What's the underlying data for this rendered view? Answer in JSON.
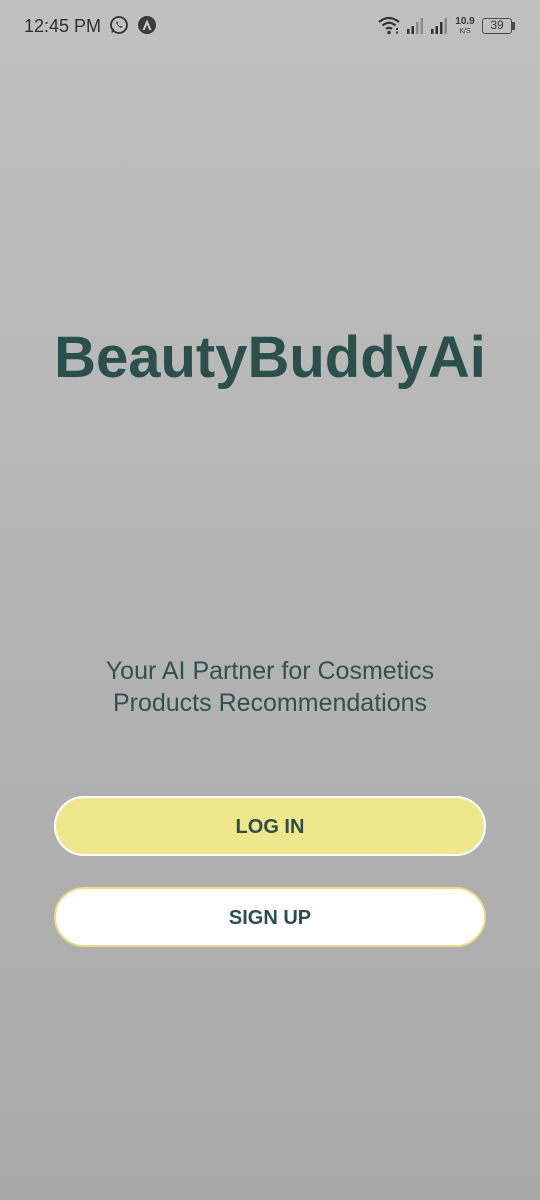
{
  "status_bar": {
    "time": "12:45 PM",
    "net_speed_value": "10.9",
    "net_speed_unit": "K/S",
    "battery_level": "39",
    "icons": [
      "whatsapp-icon",
      "app-notification-icon",
      "wifi-icon",
      "signal-icon",
      "signal-icon",
      "battery-icon"
    ]
  },
  "app": {
    "title": "BeautyBuddyAi",
    "tagline_line1": "Your AI Partner for Cosmetics",
    "tagline_line2": "Products Recommendations"
  },
  "buttons": {
    "login_label": "LOG IN",
    "signup_label": "SIGN UP"
  },
  "colors": {
    "primary_text": "#2b4f4b",
    "login_bg": "#f0e68c",
    "signup_bg": "#ffffff",
    "background_top": "#c0c0c0",
    "background_bottom": "#a9a9a9"
  }
}
